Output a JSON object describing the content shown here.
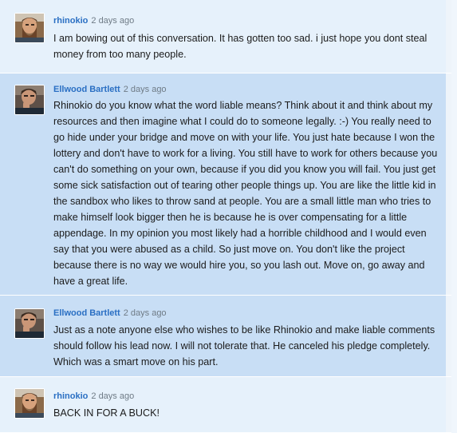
{
  "comments": [
    {
      "author": "rhinokio",
      "time": "2 days ago",
      "avatar_icon": "bearded-man-avatar-icon",
      "text": "I am bowing out of this conversation. It has gotten too sad. i just hope you dont steal money from too many people."
    },
    {
      "author": "Ellwood Bartlett",
      "time": "2 days ago",
      "avatar_icon": "man-thinking-avatar-icon",
      "text": "Rhinokio do you know what the word liable means? Think about it and think about my resources and then imagine what I could do to someone legally. :-) You really need to go hide under your bridge and move on with your life. You just hate because I won the lottery and don't have to work for a living. You still have to work for others because you can't do something on your own, because if you did you know you will fail. You just get some sick satisfaction out of tearing other people things up. You are like the little kid in the sandbox who likes to throw sand at people. You are a small little man who tries to make himself look bigger then he is because he is over compensating for a little appendage. In my opinion you most likely had a horrible childhood and I would even say that you were abused as a child. So just move on. You don't like the project because there is no way we would hire you, so you lash out. Move on, go away and have a great life."
    },
    {
      "author": "Ellwood Bartlett",
      "time": "2 days ago",
      "avatar_icon": "man-thinking-avatar-icon",
      "text": "Just as a note anyone else who wishes to be like Rhinokio and make liable comments should follow his lead now. I will not tolerate that. He canceled his pledge completely. Which was a smart move on his part."
    },
    {
      "author": "rhinokio",
      "time": "2 days ago",
      "avatar_icon": "bearded-man-avatar-icon",
      "text": "BACK IN FOR A BUCK!"
    }
  ]
}
